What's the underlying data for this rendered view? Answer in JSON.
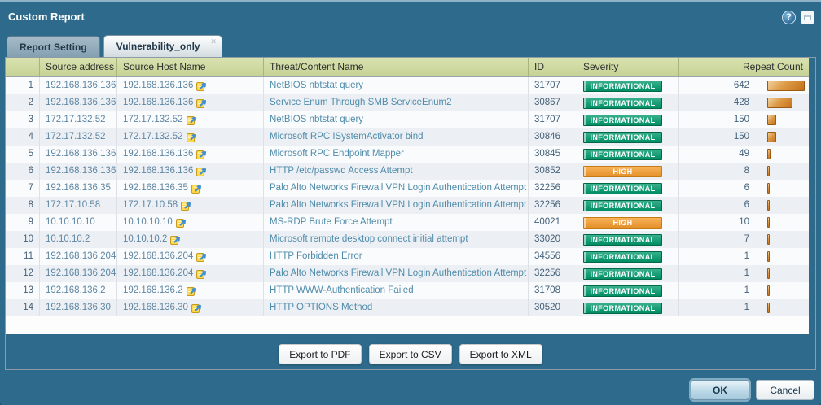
{
  "window": {
    "title": "Custom Report",
    "help_icon_glyph": "?",
    "help_icon_name": "help-icon",
    "window_icon_name": "restore-window-icon"
  },
  "tabs": [
    {
      "label": "Report Setting",
      "active": false,
      "closable": false
    },
    {
      "label": "Vulnerability_only",
      "active": true,
      "closable": true,
      "close_glyph": "✕"
    }
  ],
  "table": {
    "columns": [
      "",
      "Source address",
      "Source Host Name",
      "Threat/Content Name",
      "ID",
      "Severity",
      "Repeat Count"
    ],
    "rows": [
      {
        "n": 1,
        "src": "192.168.136.136",
        "host": "192.168.136.136",
        "threat": "NetBIOS nbtstat query",
        "id": "31707",
        "severity": "INFORMATIONAL",
        "count": 642
      },
      {
        "n": 2,
        "src": "192.168.136.136",
        "host": "192.168.136.136",
        "threat": "Service Enum Through SMB ServiceEnum2",
        "id": "30867",
        "severity": "INFORMATIONAL",
        "count": 428
      },
      {
        "n": 3,
        "src": "172.17.132.52",
        "host": "172.17.132.52",
        "threat": "NetBIOS nbtstat query",
        "id": "31707",
        "severity": "INFORMATIONAL",
        "count": 150
      },
      {
        "n": 4,
        "src": "172.17.132.52",
        "host": "172.17.132.52",
        "threat": "Microsoft RPC ISystemActivator bind",
        "id": "30846",
        "severity": "INFORMATIONAL",
        "count": 150
      },
      {
        "n": 5,
        "src": "192.168.136.136",
        "host": "192.168.136.136",
        "threat": "Microsoft RPC Endpoint Mapper",
        "id": "30845",
        "severity": "INFORMATIONAL",
        "count": 49
      },
      {
        "n": 6,
        "src": "192.168.136.136",
        "host": "192.168.136.136",
        "threat": "HTTP /etc/passwd Access Attempt",
        "id": "30852",
        "severity": "HIGH",
        "count": 8
      },
      {
        "n": 7,
        "src": "192.168.136.35",
        "host": "192.168.136.35",
        "threat": "Palo Alto Networks Firewall VPN Login Authentication Attempt",
        "id": "32256",
        "severity": "INFORMATIONAL",
        "count": 6
      },
      {
        "n": 8,
        "src": "172.17.10.58",
        "host": "172.17.10.58",
        "threat": "Palo Alto Networks Firewall VPN Login Authentication Attempt",
        "id": "32256",
        "severity": "INFORMATIONAL",
        "count": 6
      },
      {
        "n": 9,
        "src": "10.10.10.10",
        "host": "10.10.10.10",
        "threat": "MS-RDP Brute Force Attempt",
        "id": "40021",
        "severity": "HIGH",
        "count": 10
      },
      {
        "n": 10,
        "src": "10.10.10.2",
        "host": "10.10.10.2",
        "threat": "Microsoft remote desktop connect initial attempt",
        "id": "33020",
        "severity": "INFORMATIONAL",
        "count": 7
      },
      {
        "n": 11,
        "src": "192.168.136.204",
        "host": "192.168.136.204",
        "threat": "HTTP Forbidden Error",
        "id": "34556",
        "severity": "INFORMATIONAL",
        "count": 1
      },
      {
        "n": 12,
        "src": "192.168.136.204",
        "host": "192.168.136.204",
        "threat": "Palo Alto Networks Firewall VPN Login Authentication Attempt",
        "id": "32256",
        "severity": "INFORMATIONAL",
        "count": 1
      },
      {
        "n": 13,
        "src": "192.168.136.2",
        "host": "192.168.136.2",
        "threat": "HTTP WWW-Authentication Failed",
        "id": "31708",
        "severity": "INFORMATIONAL",
        "count": 1
      },
      {
        "n": 14,
        "src": "192.168.136.30",
        "host": "192.168.136.30",
        "threat": "HTTP OPTIONS Method",
        "id": "30520",
        "severity": "INFORMATIONAL",
        "count": 1
      }
    ],
    "max_repeat_count": 642,
    "host_icon_name": "resolve-hostname-icon"
  },
  "severity_colors": {
    "INFORMATIONAL": "#00996b",
    "HIGH": "#f79d2d"
  },
  "export_buttons": {
    "pdf": "Export to PDF",
    "csv": "Export to CSV",
    "xml": "Export to XML"
  },
  "footer": {
    "ok": "OK",
    "cancel": "Cancel"
  },
  "colors": {
    "dialog_background": "#2e6a8b",
    "table_header": "#ccd79e",
    "repeat_bar": "#c4711a"
  }
}
